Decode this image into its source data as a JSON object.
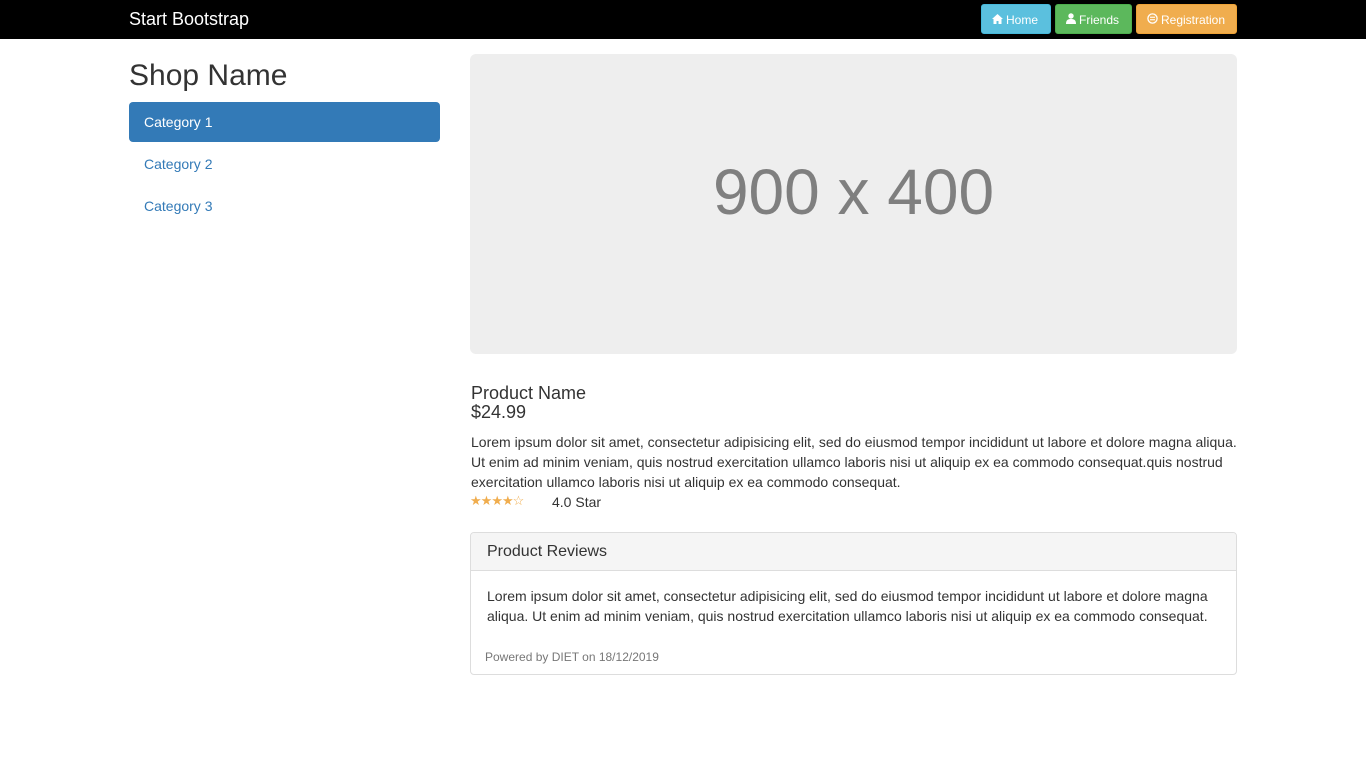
{
  "navbar": {
    "brand": "Start Bootstrap",
    "buttons": {
      "home": "Home",
      "friends": "Friends",
      "registration": "Registration"
    }
  },
  "sidebar": {
    "title": "Shop Name",
    "categories": [
      "Category 1",
      "Category 2",
      "Category 3"
    ]
  },
  "hero": {
    "label": "900 x 400"
  },
  "product": {
    "name": "Product Name",
    "price": "$24.99",
    "description": "Lorem ipsum dolor sit amet, consectetur adipisicing elit, sed do eiusmod tempor incididunt ut labore et dolore magna aliqua. Ut enim ad minim veniam, quis nostrud exercitation ullamco laboris nisi ut aliquip ex ea commodo consequat.quis nostrud exercitation ullamco laboris nisi ut aliquip ex ea commodo consequat.",
    "rating_stars": 4,
    "rating_max": 5,
    "rating_text": "4.0 Star"
  },
  "reviews": {
    "title": "Product Reviews",
    "body": "Lorem ipsum dolor sit amet, consectetur adipisicing elit, sed do eiusmod tempor incididunt ut labore et dolore magna aliqua. Ut enim ad minim veniam, quis nostrud exercitation ullamco laboris nisi ut aliquip ex ea commodo consequat.",
    "footnote": "Powered by DIET on 18/12/2019"
  },
  "colors": {
    "navbar": "#000000",
    "primary": "#337ab7",
    "info": "#5bc0de",
    "success": "#5cb85c",
    "warning": "#f0ad4e"
  },
  "icons": [
    "home-icon",
    "user-icon",
    "registration-icon",
    "star-icon"
  ]
}
